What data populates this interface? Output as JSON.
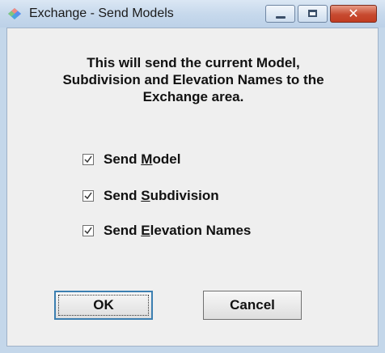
{
  "window": {
    "title": "Exchange - Send Models",
    "icon": "app-diamond-icon",
    "controls": {
      "minimize": "minimize-icon",
      "maximize": "maximize-icon",
      "close": "close-icon"
    }
  },
  "message": {
    "text": "This will send the current Model,\nSubdivision and Elevation Names to the\nExchange area."
  },
  "options": [
    {
      "prefix": "Send ",
      "mnemonic": "M",
      "rest": "odel",
      "checked": true
    },
    {
      "prefix": "Send ",
      "mnemonic": "S",
      "rest": "ubdivision",
      "checked": true
    },
    {
      "prefix": "Send ",
      "mnemonic": "E",
      "rest": "levation Names",
      "checked": true
    }
  ],
  "buttons": {
    "ok": "OK",
    "cancel": "Cancel"
  },
  "colors": {
    "close_button": "#c74a30",
    "default_button_border": "#3c7fb1",
    "client_background": "#efefef"
  }
}
